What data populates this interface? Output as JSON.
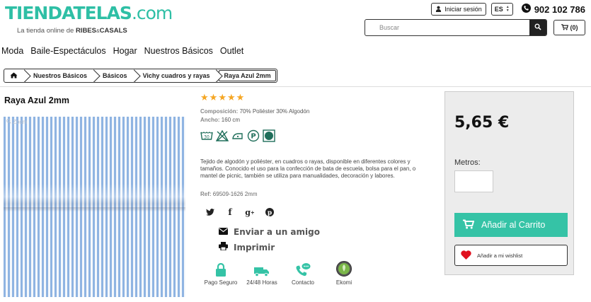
{
  "header": {
    "logo_main": "TIENDATELAS",
    "logo_dotcom": ".com",
    "logo_tagline": "La tienda online de",
    "logo_brand": "RIBES",
    "logo_brand_amp": "&",
    "logo_brand2": "CASALS",
    "login_label": "Iniciar sesión",
    "lang_value": "ES",
    "phone": "902 102 786",
    "search_placeholder": "Buscar",
    "cart_label": "(0)"
  },
  "nav": {
    "items": [
      "Moda",
      "Baile-Espectáculos",
      "Hogar",
      "Nuestros Básicos",
      "Outlet"
    ]
  },
  "breadcrumb": {
    "items": [
      "Nuestros Básicos",
      "Básicos",
      "Vichy cuadros y rayas",
      "Raya Azul 2mm"
    ]
  },
  "product": {
    "title": "Raya Azul 2mm",
    "zoom_label": "Zoom",
    "rating_stars": 5,
    "composition_label": "Composición:",
    "composition_value": "70% Poliéster 30% Algodón",
    "width_label": "Ancho:",
    "width_value": "160 cm",
    "description": "Tejido de algodón y poliéster, en cuadros o rayas, disponible en diferentes colores y tamaños. Conocido el uso para la confección de bata de escuela, bolsa para el pan, o mantel de picnic, también se utiliza para manualidades, decoración y labores.",
    "ref_label": "Ref:",
    "ref_value": "69509-1626 2mm",
    "send_friend": "Enviar a un amigo",
    "print": "Imprimir",
    "price": "5,65 €",
    "metros_label": "Metros:",
    "add_to_cart": "Añadir al Carrito",
    "wishlist": "Añadir a mi wishlist"
  },
  "badges": [
    {
      "label": "Pago Seguro",
      "icon": "lock-icon"
    },
    {
      "label": "24/48 Horas",
      "icon": "truck-icon"
    },
    {
      "label": "Contacto",
      "icon": "phone-chat-icon"
    },
    {
      "label": "Ekomi",
      "icon": "ekomi-icon"
    }
  ],
  "colors": {
    "brand": "#2ebfa5",
    "add_to_cart": "#35c3a6",
    "stars": "#f5a623",
    "badge_green": "#35c3a6"
  }
}
